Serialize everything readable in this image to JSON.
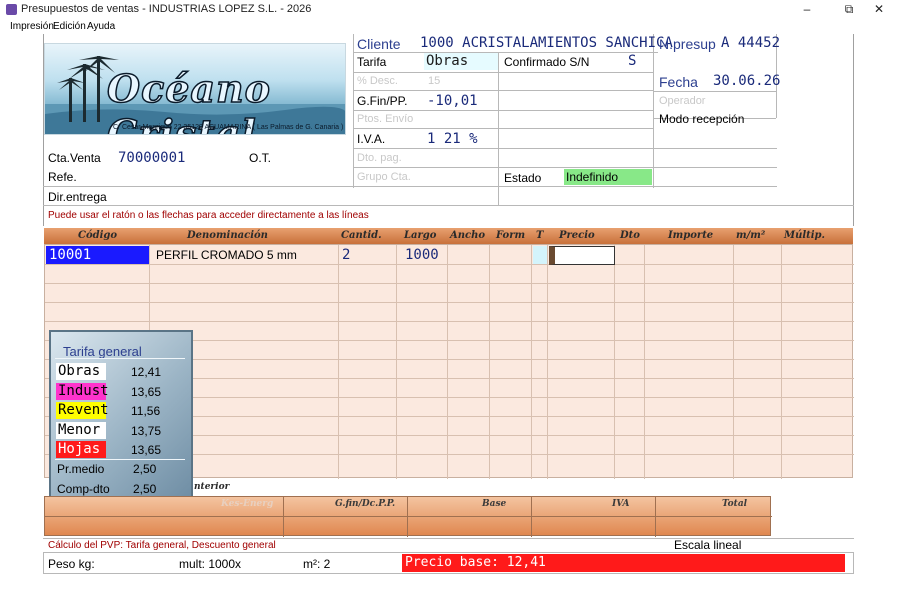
{
  "window": {
    "title": "Presupuestos de ventas - INDUSTRIAS LOPEZ S.L. - 2026",
    "minimize": "–",
    "restore": "⧉",
    "close": "✕"
  },
  "menu": [
    "Impresión",
    "Edición",
    "Ayuda"
  ],
  "logo": {
    "name": "Océano Cristal",
    "address": "C/ Cesar Manrique 22   35129 ACUAMARINA  ( Las Palmas de G. Canaria )"
  },
  "header": {
    "cliente_label": "Cliente",
    "cliente_value": "1000 ACRISTALAMIENTOS SANCHICA",
    "npresup_label": "N.presup",
    "npresup_value": "A 44452",
    "tarifa_label": "Tarifa",
    "tarifa_value": "Obras",
    "confirmado_label": "Confirmado S/N",
    "confirmado_value": "S",
    "fecha_label": "Fecha",
    "fecha_value": "30.06.26",
    "pdesc_label": "% Desc.",
    "pdesc_value": "15",
    "gfin_label": "G.Fin/PP.",
    "gfin_value": "-10,01",
    "iva_label": "I.V.A.",
    "iva_value": "1 21 %",
    "portes_label": "Ptos. Envío",
    "modo_label": "Modo recepción",
    "operador_label": "Operador",
    "dto_pag_label": "Dto. pag.",
    "grupo_label": "Grupo Cta.",
    "estado_label": "Estado",
    "estado_value": "Indefinido",
    "cta_venta_label": "Cta.Venta",
    "cta_venta_value": "70000001",
    "ot_label": "O.T.",
    "refe_label": "Refe.",
    "direntrega_label": "Dir.entrega",
    "hint": "Puede usar el ratón o las flechas para acceder directamente a las líneas"
  },
  "columns": [
    "Código",
    "Denominación",
    "Cantid.",
    "Largo",
    "Ancho",
    "Form",
    "T",
    "Precio",
    "Dto",
    "Importe",
    "m/m²",
    "Múltip."
  ],
  "lines": [
    {
      "codigo": "10001",
      "denominacion": "PERFIL CROMADO 5 mm",
      "cantidad": "2",
      "largo": "1000"
    }
  ],
  "tarifa_popup": {
    "title": "Tarifa general",
    "rows": [
      {
        "name": "Obras",
        "value": "12,41",
        "color": "#ffffff"
      },
      {
        "name": "Indust",
        "value": "13,65",
        "color": "#ff33cc"
      },
      {
        "name": "Revent",
        "value": "11,56",
        "color": "#ffff00"
      },
      {
        "name": "Menor",
        "value": "13,75",
        "color": "#ffffff"
      },
      {
        "name": "Hojas",
        "value": "13,65",
        "color": "#ff1a1a"
      }
    ],
    "prmedio_label": "Pr.medio",
    "prmedio_value": "2,50",
    "compdto_label": "Comp-dto",
    "compdto_value": "2,50"
  },
  "totals": {
    "anterior_label": "nterior",
    "headers": [
      "Kes-Energ",
      "G.fin/Dc.P.P.",
      "Base",
      "IVA",
      "Total"
    ]
  },
  "footer": {
    "calc_note": "Cálculo del PVP: Tarifa general, Descuento general",
    "escala": "Escala lineal",
    "peso_label": "Peso kg:",
    "mult": "mult: 1000x",
    "m2": "m²: 2",
    "precio_base": "Precio base: 12,41"
  },
  "colors": {
    "accent_header": "#c8703a",
    "estado_bg": "#88e888",
    "selected_cell": "#1a1aff",
    "price_bar": "#ff1a1a"
  }
}
